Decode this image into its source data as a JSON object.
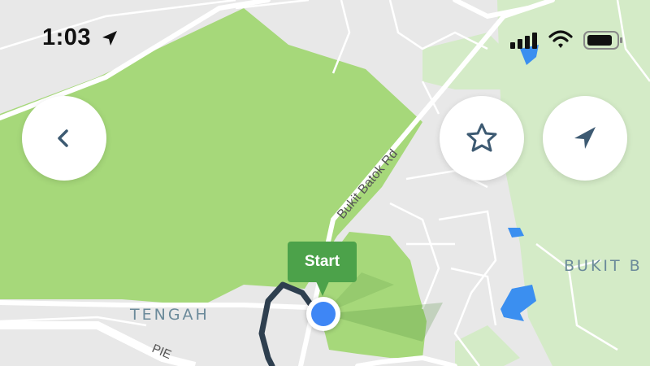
{
  "status_bar": {
    "time": "1:03",
    "location_icon": "location-arrow-icon",
    "signal_icon": "cellular-signal-icon",
    "wifi_icon": "wifi-icon",
    "battery_icon": "battery-icon"
  },
  "map": {
    "labels": {
      "road": "Bukit Batok Rd",
      "area_west": "TENGAH",
      "area_east": "BUKIT B",
      "expressway": "PIE"
    },
    "colors": {
      "park": "#a6d87a",
      "route": "#2e3f4f",
      "user_location": "#3e86f5",
      "start_marker": "#4ca24a",
      "water": "#3b8ff0"
    }
  },
  "controls": {
    "back_icon": "chevron-left-icon",
    "favorite_icon": "star-icon",
    "navigate_icon": "navigation-arrow-icon"
  },
  "markers": {
    "start_label": "Start"
  }
}
